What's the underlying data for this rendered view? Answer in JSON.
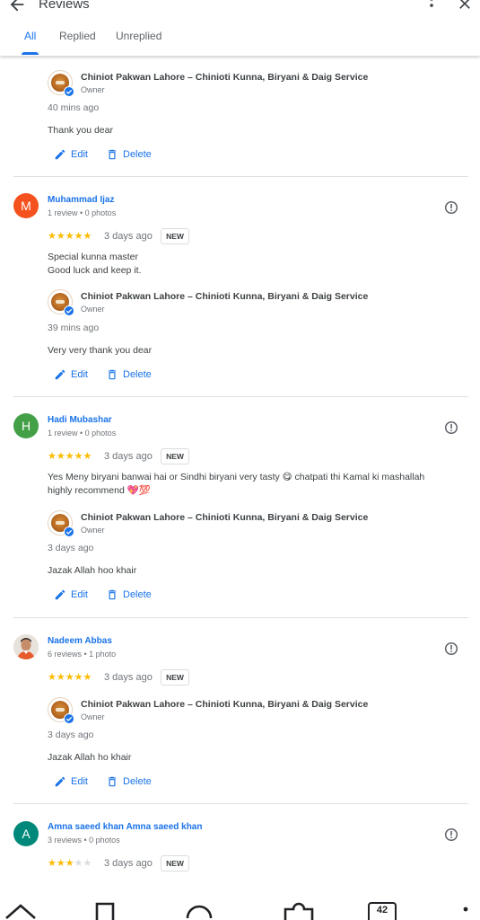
{
  "header": {
    "title": "Reviews"
  },
  "tabs": [
    {
      "label": "All",
      "active": true
    },
    {
      "label": "Replied",
      "active": false
    },
    {
      "label": "Unreplied",
      "active": false
    }
  ],
  "owner": {
    "name": "Chiniot Pakwan Lahore – Chinioti Kunna, Biryani & Daig Service",
    "role": "Owner"
  },
  "actions": {
    "edit": "Edit",
    "delete": "Delete"
  },
  "new_badge": "NEW",
  "top_reply": {
    "time": "40 mins ago",
    "text": "Thank you dear"
  },
  "reviews": [
    {
      "initial": "M",
      "avatar_color": "#f4511e",
      "name": "Muhammad Ijaz",
      "meta": "1 review • 0 photos",
      "rating": 5,
      "date": "3 days ago",
      "text_line1": "Special kunna master",
      "text_line2": "Good luck and keep it.",
      "reply_time": "39 mins ago",
      "reply": "Very very thank you dear"
    },
    {
      "initial": "H",
      "avatar_color": "#43a047",
      "name": "Hadi Mubashar",
      "meta": "1 review • 0 photos",
      "rating": 5,
      "date": "3 days ago",
      "text_line1": "Yes Meny biryani banwai hai or Sindhi biryani very tasty 😋 chatpati thi Kamal ki mashallah",
      "text_line2": "highly recommend 💖💯",
      "reply_time": "3 days ago",
      "reply": "Jazak Allah hoo khair"
    },
    {
      "initial": "",
      "avatar_color": "#d7ccc8",
      "name": "Nadeem Abbas",
      "meta": "6 reviews • 1 photo",
      "rating": 5,
      "date": "3 days ago",
      "text_line1": "",
      "text_line2": "",
      "reply_time": "3 days ago",
      "reply": "Jazak Allah ho khair"
    },
    {
      "initial": "A",
      "avatar_color": "#00897b",
      "name": "Amna saeed khan Amna saeed khan",
      "meta": "3 reviews • 0 photos",
      "rating": 3,
      "date": "3 days ago",
      "text_line1": "",
      "text_line2": "",
      "reply_time": "",
      "reply": ""
    }
  ],
  "bottom_nav": {
    "tabs_count": "42"
  },
  "colors": {
    "accent": "#1a73e8",
    "star": "#fbbc04",
    "star_empty": "#dadce0"
  }
}
